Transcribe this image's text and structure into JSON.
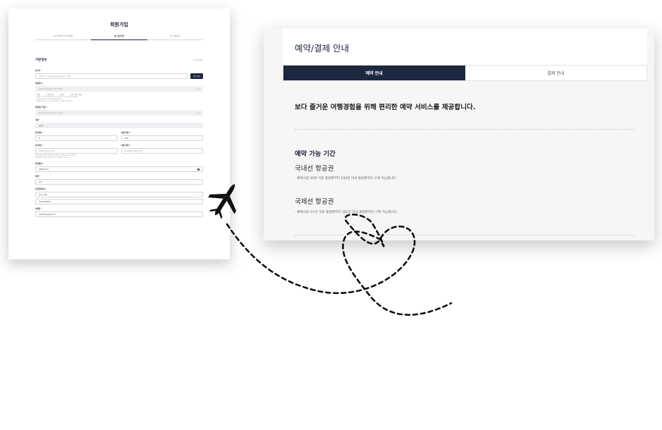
{
  "signup": {
    "title": "회원가입",
    "steps": [
      "01 약관동의 및 본인인증",
      "02 정보입력",
      "03 가입완료"
    ],
    "section_title": "기본정보",
    "required_note": "• 필수입력사항",
    "fields": {
      "id_label": "아이디 *",
      "id_placeholder": "영문자 또는 영문자/숫자를 혼용하여 6~16자",
      "id_check": "중복 확인",
      "password_label": "비밀번호 *",
      "password_placeholder": "영문/숫자/특수문자 조합 8~15자",
      "password_toggle": "표시",
      "password_opts": [
        "영문",
        "특수문자",
        "숫자",
        "8~15자 조합"
      ],
      "password_notes": [
        "• 영문자, 숫자, 특수문자 중 2가지 이상 조합 8~15자로 입력해 주세요.",
        "• 동일문자 3회 이상 연속 사용은 불가합니다.",
        "• 아이디와 동일하거나 포함된 비밀번호는 사용할 수 없습니다."
      ],
      "password_confirm_label": "비밀번호 확인 *",
      "password_confirm_placeholder": "영문/숫자/특수문자 조합 8~15자",
      "password_confirm_toggle": "표시",
      "name_label": "이름 *",
      "name_value": "홍길동",
      "last_name_label": "성(영문) *",
      "last_name_value": "G",
      "first_name_label": "이름(영문) *",
      "first_name_value": "GILD",
      "passport_last_label": "성(영문) *",
      "passport_last_placeholder": "HONG (여권과 동일)",
      "passport_first_label": "이름(영문) *",
      "passport_first_placeholder": "GILDONG (여권과 동일)",
      "name_notes": [
        "여권상 영문 성명과 일치해야 하며 예약 시 탑승자 정보로 사용됩니다.",
        "영문 성명이 여권과 다를 경우 탑승이 거절될 수 있습니다."
      ],
      "birth_label": "생년월일 *",
      "birth_value": "1990-01-01",
      "gender_label": "성별 *",
      "gender_value": "선택",
      "phone_label": "휴대전화번호 *",
      "country_value": "한국 (+82)",
      "phone_value": "01012345678",
      "email_label": "이메일 *",
      "email_value": "user@example.com"
    }
  },
  "reservation": {
    "title": "예약/결제 안내",
    "tabs": [
      "예약 안내",
      "결제 안내"
    ],
    "lead": "보다 즐거운 여행경험을 위해 편리한 예약 서비스를 제공합니다.",
    "section_title": "예약 가능 기간",
    "domestic_title": "국내선 항공권",
    "domestic_desc": "- 예매시점 30분 이후 출발편부터 240일 이내 출발편까지 구매 가능합니다.",
    "international_title": "국제선 항공권",
    "international_desc": "- 예매시점 3시간 이후 출발편부터 361일 이내 출발편까지 구매 가능합니다."
  },
  "colors": {
    "navy": "#1d2740",
    "highlight": "#e4f06a",
    "panel_bg": "#f6f6f7"
  },
  "icons": {
    "plane": "airplane-icon",
    "path": "dashed-heart-flight-path"
  }
}
